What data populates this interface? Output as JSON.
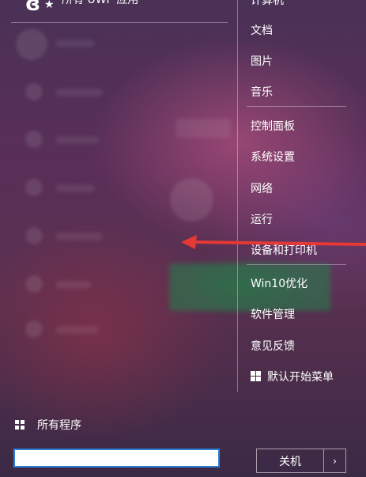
{
  "header": {
    "logo_glyph": "ɞ",
    "title": "所有 UWP 应用"
  },
  "right_menu": {
    "group1": [
      "计算机",
      "文档",
      "图片",
      "音乐"
    ],
    "group2": [
      "控制面板",
      "系统设置",
      "网络",
      "运行",
      "设备和打印机"
    ],
    "group3": [
      "Win10优化",
      "软件管理",
      "意见反馈"
    ],
    "default_start_menu": "默认开始菜单"
  },
  "all_programs": "所有程序",
  "search": {
    "value": "",
    "placeholder": ""
  },
  "shutdown": {
    "label": "关机",
    "arrow_glyph": "›"
  },
  "colors": {
    "arrow": "#e53935",
    "input_border": "#2d7fd3",
    "background_top": "#4a3155",
    "background_bottom": "#3b2a45"
  }
}
